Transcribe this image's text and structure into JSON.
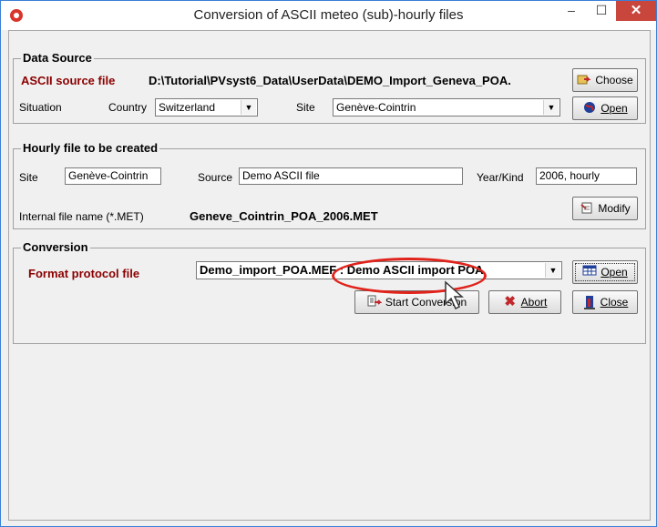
{
  "window": {
    "title": "Conversion of ASCII meteo (sub)-hourly files",
    "minimize": "–",
    "maximize": "☐",
    "close": "✕"
  },
  "data_source": {
    "legend": "Data Source",
    "ascii_label": "ASCII source file",
    "ascii_path": "D:\\Tutorial\\PVsyst6_Data\\UserData\\DEMO_Import_Geneva_POA.",
    "choose_btn": "Choose",
    "situation_label": "Situation",
    "country_label": "Country",
    "country_value": "Switzerland",
    "site_label": "Site",
    "site_value": "Genève-Cointrin",
    "open_btn": "Open"
  },
  "hourly_file": {
    "legend": "Hourly file to be created",
    "site_label": "Site",
    "site_value": "Genève-Cointrin",
    "source_label": "Source",
    "source_value": "Demo ASCII file",
    "yearkind_label": "Year/Kind",
    "yearkind_value": "2006, hourly",
    "internal_label": "Internal file name  (*.MET)",
    "internal_value": "Geneve_Cointrin_POA_2006.MET",
    "modify_btn": "Modify"
  },
  "conversion": {
    "legend": "Conversion",
    "format_label": "Format protocol file",
    "format_value": "Demo_import_POA.MEF  : Demo ASCII import POA",
    "open_btn": "Open",
    "start_btn": "Start Conversion",
    "abort_btn": "Abort",
    "close_btn": "Close"
  },
  "icons": {
    "choose": "folder-arrow-icon",
    "open": "globe-icon",
    "modify": "edit-icon",
    "start": "convert-icon",
    "abort": "x-icon",
    "close": "exit-door-icon"
  },
  "colors": {
    "accent_red": "#8b0000",
    "highlight_ellipse": "#e0231b",
    "close_button": "#c9463d"
  }
}
